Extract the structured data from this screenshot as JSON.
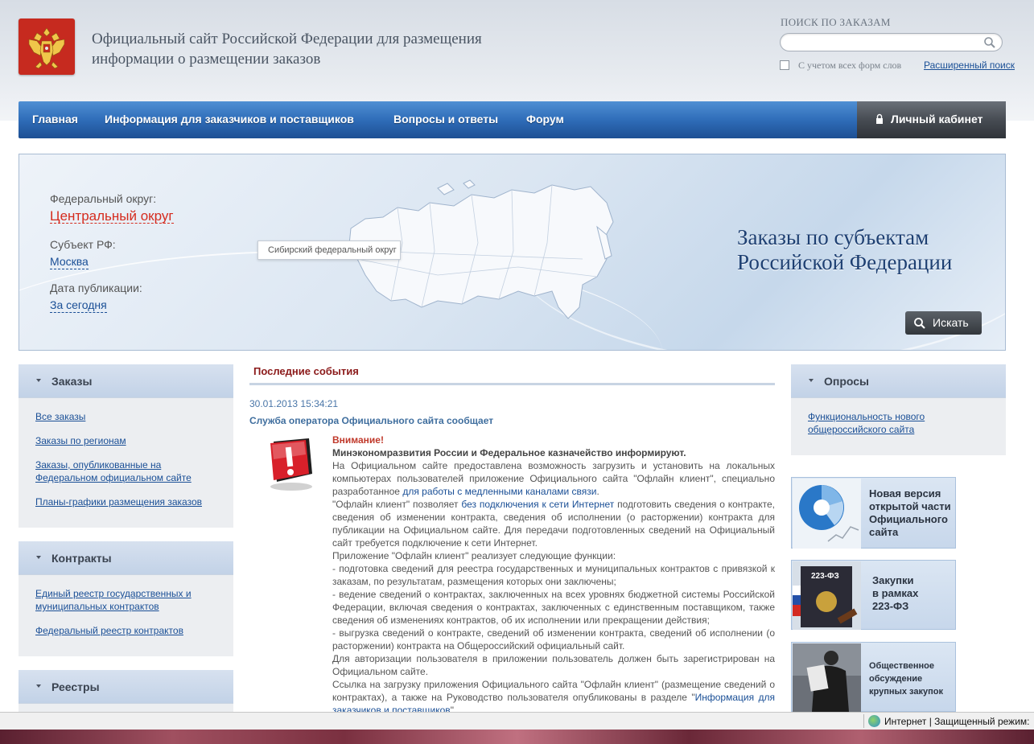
{
  "header": {
    "site_title": "Официальный сайт Российской Федерации для размещения информации о размещении заказов",
    "search_label": "ПОИСК ПО ЗАКАЗАМ",
    "search_value": "",
    "checkbox_label": "С учетом всех форм слов",
    "advanced_search": "Расширенный поиск"
  },
  "nav": {
    "items": [
      "Главная",
      "Информация для заказчиков и поставщиков",
      "Вопросы и ответы",
      "Форум"
    ],
    "cabinet": "Личный кабинет"
  },
  "banner": {
    "district_label": "Федеральный округ:",
    "district_value": "Центральный округ",
    "subject_label": "Субъект РФ:",
    "subject_value": "Москва",
    "date_label": "Дата публикации:",
    "date_value": "За сегодня",
    "tooltip": "Сибирский федеральный округ",
    "title_line1": "Заказы по субъектам",
    "title_line2": "Российской Федерации",
    "search_button": "Искать"
  },
  "left": {
    "orders": {
      "title": "Заказы",
      "links": [
        "Все заказы",
        "Заказы по регионам",
        "Заказы, опубликованные на Федеральном официальном сайте",
        "Планы-графики размещения заказов"
      ]
    },
    "contracts": {
      "title": "Контракты",
      "links": [
        "Единый реестр государственных и муниципальных контрактов",
        "Федеральный реестр контрактов"
      ]
    },
    "registers": {
      "title": "Реестры"
    }
  },
  "events": {
    "title": "Последние события",
    "date": "30.01.2013 15:34:21",
    "headline": "Служба оператора Официального сайта сообщает",
    "attention": "Внимание!",
    "lead": "Минэкономразвития России и Федеральное казначейство информируют.",
    "p1a": "На Официальном сайте предоставлена возможность загрузить и установить на локальных компьютерах пользователей приложение Официального сайта \"Офлайн клиент\", специально разработанное ",
    "p1_link": "для работы с медленными каналами связи",
    "p1b": ".",
    "p2a": "\"Офлайн клиент\" позволяет ",
    "p2_link": "без подключения к сети Интернет",
    "p2b": " подготовить сведения о контракте, сведения об изменении контракта, сведения об исполнении (о расторжении) контракта для публикации на Официальном сайте. Для передачи подготовленных сведений на Официальный сайт требуется подключение к сети Интернет.",
    "p3": "Приложение \"Офлайн клиент\" реализует следующие функции:",
    "p4": "- подготовка сведений для реестра государственных и муниципальных контрактов с привязкой к заказам, по результатам, размещения которых они заключены;",
    "p5": "- ведение сведений о контрактах, заключенных на всех уровнях бюджетной системы Российской Федерации, включая сведения о контрактах, заключенных с единственным поставщиком, также сведения об изменениях контрактов, об их исполнении или прекращении действия;",
    "p6": "- выгрузка сведений о контракте, сведений об изменении контракта, сведений об исполнении (о расторжении) контракта на Общероссийский официальный сайт.",
    "p7": "Для авторизации пользователя в приложении пользователь должен быть зарегистрирован на Официальном сайте.",
    "p8a": "Ссылка на загрузку приложения Официального сайта \"Офлайн клиент\" (размещение сведений о контрактах), а также на Руководство пользователя опубликованы в разделе \"",
    "p8_link": "Информация для заказчиков и поставщиков",
    "p8b": "\"."
  },
  "right": {
    "polls": {
      "title": "Опросы",
      "link": "Функциональность нового общероссийского сайта"
    },
    "promo1": [
      "Новая версия",
      "открытой части",
      "Официального",
      "сайта"
    ],
    "promo2": [
      "Закупки",
      "в рамках",
      "223-ФЗ"
    ],
    "promo2_book": "223-ФЗ",
    "promo3": [
      "Общественное",
      "обсуждение",
      "крупных закупок"
    ]
  },
  "statusbar": {
    "text": "Интернет | Защищенный режим:"
  }
}
